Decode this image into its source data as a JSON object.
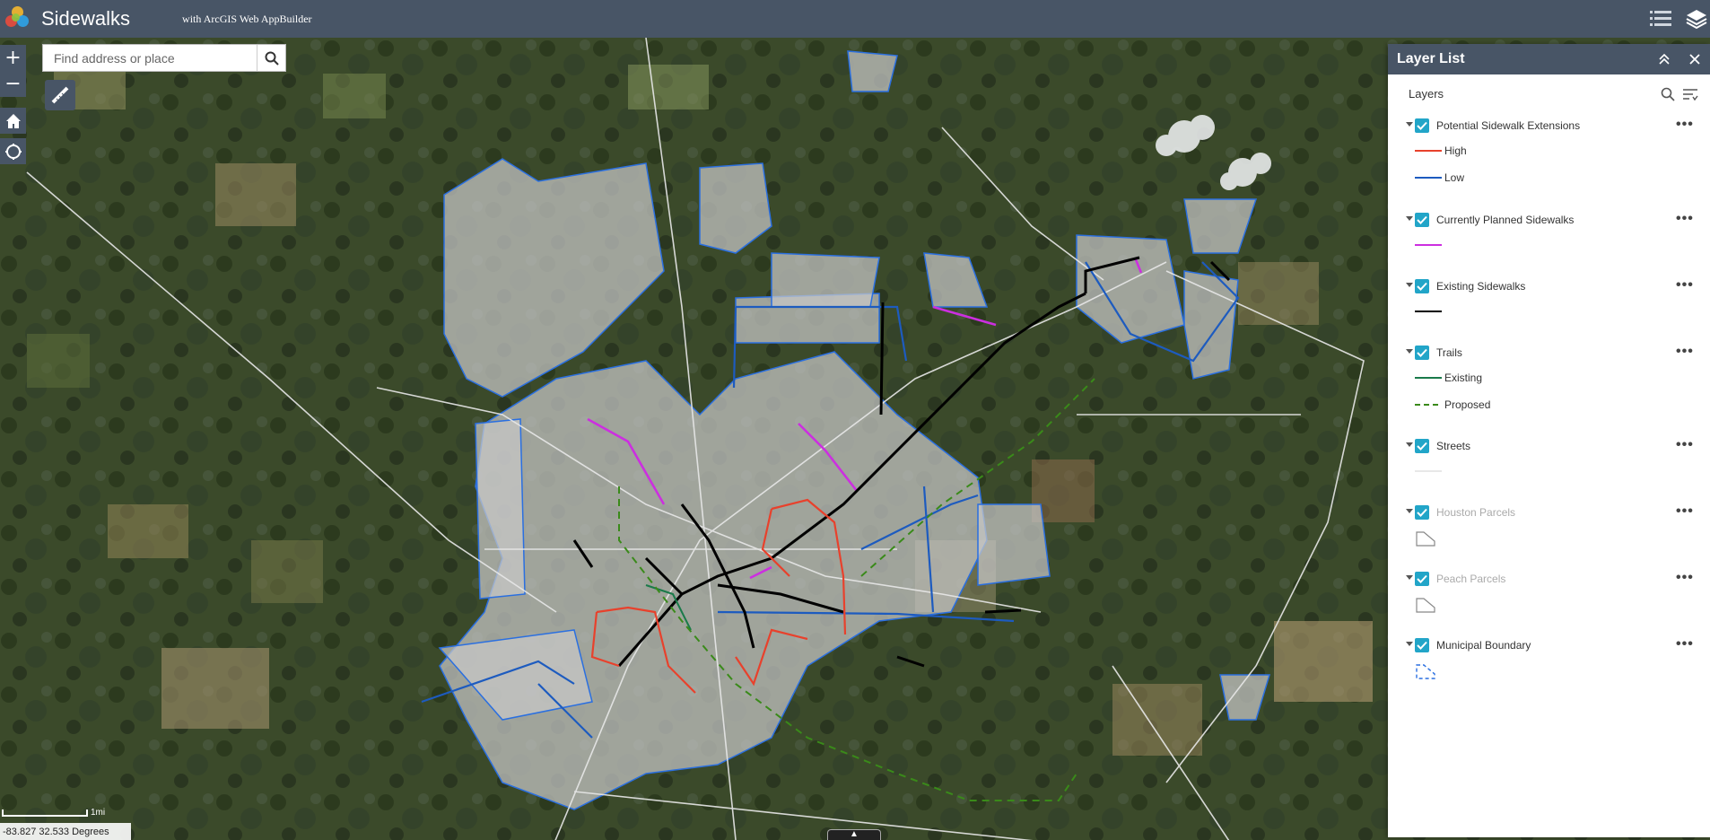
{
  "header": {
    "title": "Sidewalks",
    "subtitle": "with ArcGIS Web AppBuilder"
  },
  "map": {
    "search_placeholder": "Find address or place",
    "coordinates": "-83.827 32.533 Degrees",
    "scale_label": "1mi",
    "attribution_toggle": "▲"
  },
  "panel": {
    "title": "Layer List",
    "layers_label": "Layers",
    "more_label": "•••",
    "layers": [
      {
        "name": "Potential Sidewalk Extensions",
        "visible": true,
        "dimmed": false,
        "legend": [
          {
            "label": "High",
            "color": "#e8412c",
            "style": "solid"
          },
          {
            "label": "Low",
            "color": "#1d5bbf",
            "style": "solid"
          }
        ]
      },
      {
        "name": "Currently Planned Sidewalks",
        "visible": true,
        "dimmed": false,
        "legend": [
          {
            "label": "",
            "color": "#cc2fe0",
            "style": "solid"
          }
        ]
      },
      {
        "name": "Existing Sidewalks",
        "visible": true,
        "dimmed": false,
        "legend": [
          {
            "label": "",
            "color": "#000000",
            "style": "solid"
          }
        ]
      },
      {
        "name": "Trails",
        "visible": true,
        "dimmed": false,
        "legend": [
          {
            "label": "Existing",
            "color": "#1a7a4a",
            "style": "solid"
          },
          {
            "label": "Proposed",
            "color": "#3a8a1a",
            "style": "dashed"
          }
        ]
      },
      {
        "name": "Streets",
        "visible": true,
        "dimmed": false,
        "legend": [
          {
            "label": "",
            "color": "#e8e8e8",
            "style": "solid"
          }
        ]
      },
      {
        "name": "Houston Parcels",
        "visible": true,
        "dimmed": true,
        "legend": [
          {
            "label": "",
            "color": "#888888",
            "style": "polygon"
          }
        ]
      },
      {
        "name": "Peach Parcels",
        "visible": true,
        "dimmed": true,
        "legend": [
          {
            "label": "",
            "color": "#888888",
            "style": "polygon"
          }
        ]
      },
      {
        "name": "Municipal Boundary",
        "visible": true,
        "dimmed": false,
        "legend": [
          {
            "label": "",
            "color": "#2a6fe0",
            "style": "boundary"
          }
        ]
      }
    ]
  },
  "colors": {
    "header_bg": "#485566",
    "checkbox": "#22a5c8",
    "high": "#e8412c",
    "low": "#1d5bbf",
    "planned": "#cc2fe0",
    "existing_sidewalk": "#000000",
    "trail_existing": "#1a7a4a",
    "trail_proposed": "#3a8a1a",
    "street": "#e8e8e8",
    "boundary": "#2a6fe0",
    "parcel_fill": "#c8c8c8"
  },
  "icons": [
    "app-logo-icon",
    "layer-list-toggle-icon",
    "layers-icon",
    "zoom-in-icon",
    "zoom-out-icon",
    "home-icon",
    "locate-icon",
    "search-icon",
    "measure-icon",
    "collapse-icon",
    "close-icon",
    "filter-icon",
    "checkbox-icon",
    "more-icon"
  ]
}
